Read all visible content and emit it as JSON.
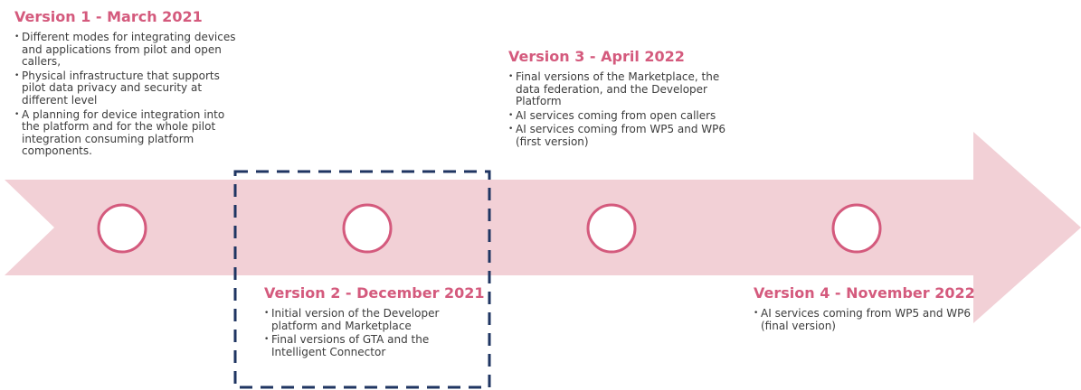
{
  "colors": {
    "accent": "#d45a7d",
    "arrow": "#f2d0d6",
    "marker_fill": "#ffffff",
    "highlight_box": "#1f3562",
    "text": "#3c3c3c"
  },
  "milestones": [
    {
      "title": "Version 1 - March 2021",
      "items": [
        "Different modes for integrating devices and applications from pilot and open callers,",
        "Physical infrastructure that supports pilot data privacy and security at different level",
        "A planning for device integration into the platform and for the whole pilot integration consuming platform components."
      ]
    },
    {
      "title": "Version 2 - December 2021",
      "highlighted": true,
      "items": [
        "Initial version of the Developer platform and Marketplace",
        "Final versions of GTA and the Intelligent Connector"
      ]
    },
    {
      "title": "Version 3 - April 2022",
      "items": [
        "Final versions of the Marketplace, the data federation, and the Developer Platform",
        "AI services coming from open callers",
        "AI services coming from WP5 and WP6 (first version)"
      ]
    },
    {
      "title": "Version 4 - November 2022",
      "items": [
        "AI services coming from WP5 and WP6 (final version)"
      ]
    }
  ]
}
